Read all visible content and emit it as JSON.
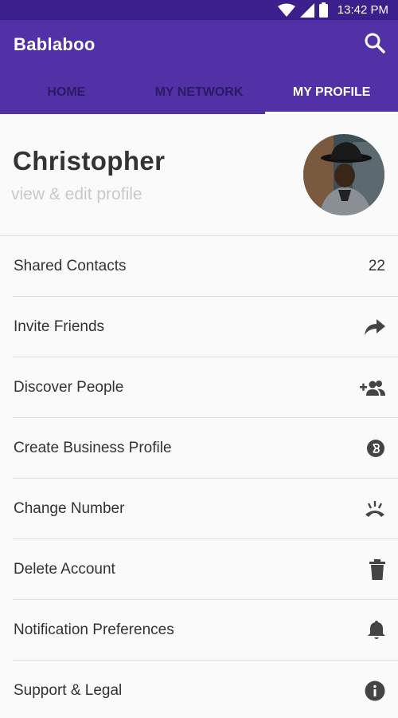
{
  "status_bar": {
    "time": "13:42 PM",
    "icons": [
      "wifi-icon",
      "cell-signal-icon",
      "battery-icon"
    ]
  },
  "app": {
    "title": "Bablaboo",
    "search_icon": "search-icon"
  },
  "tabs": [
    {
      "label": "HOME",
      "active": false
    },
    {
      "label": "MY NETWORK",
      "active": false
    },
    {
      "label": "MY PROFILE",
      "active": true
    }
  ],
  "profile": {
    "name": "Christopher",
    "subtitle": "view & edit profile"
  },
  "menu": [
    {
      "label": "Shared Contacts",
      "value": "22"
    },
    {
      "label": "Invite Friends",
      "icon": "share-forward-icon"
    },
    {
      "label": "Discover People",
      "icon": "add-people-icon"
    },
    {
      "label": "Create Business Profile",
      "icon": "business-profile-icon"
    },
    {
      "label": "Change Number",
      "icon": "phone-ring-icon"
    },
    {
      "label": "Delete Account",
      "icon": "trash-icon"
    },
    {
      "label": "Notification Preferences",
      "icon": "bell-icon"
    },
    {
      "label": "Support & Legal",
      "icon": "info-icon"
    }
  ],
  "colors": {
    "status_bar": "#3b1f8c",
    "app_bar": "#5131a5",
    "inactive_tab": "#2a1a66",
    "background": "#fafafa",
    "icon": "#444444"
  }
}
